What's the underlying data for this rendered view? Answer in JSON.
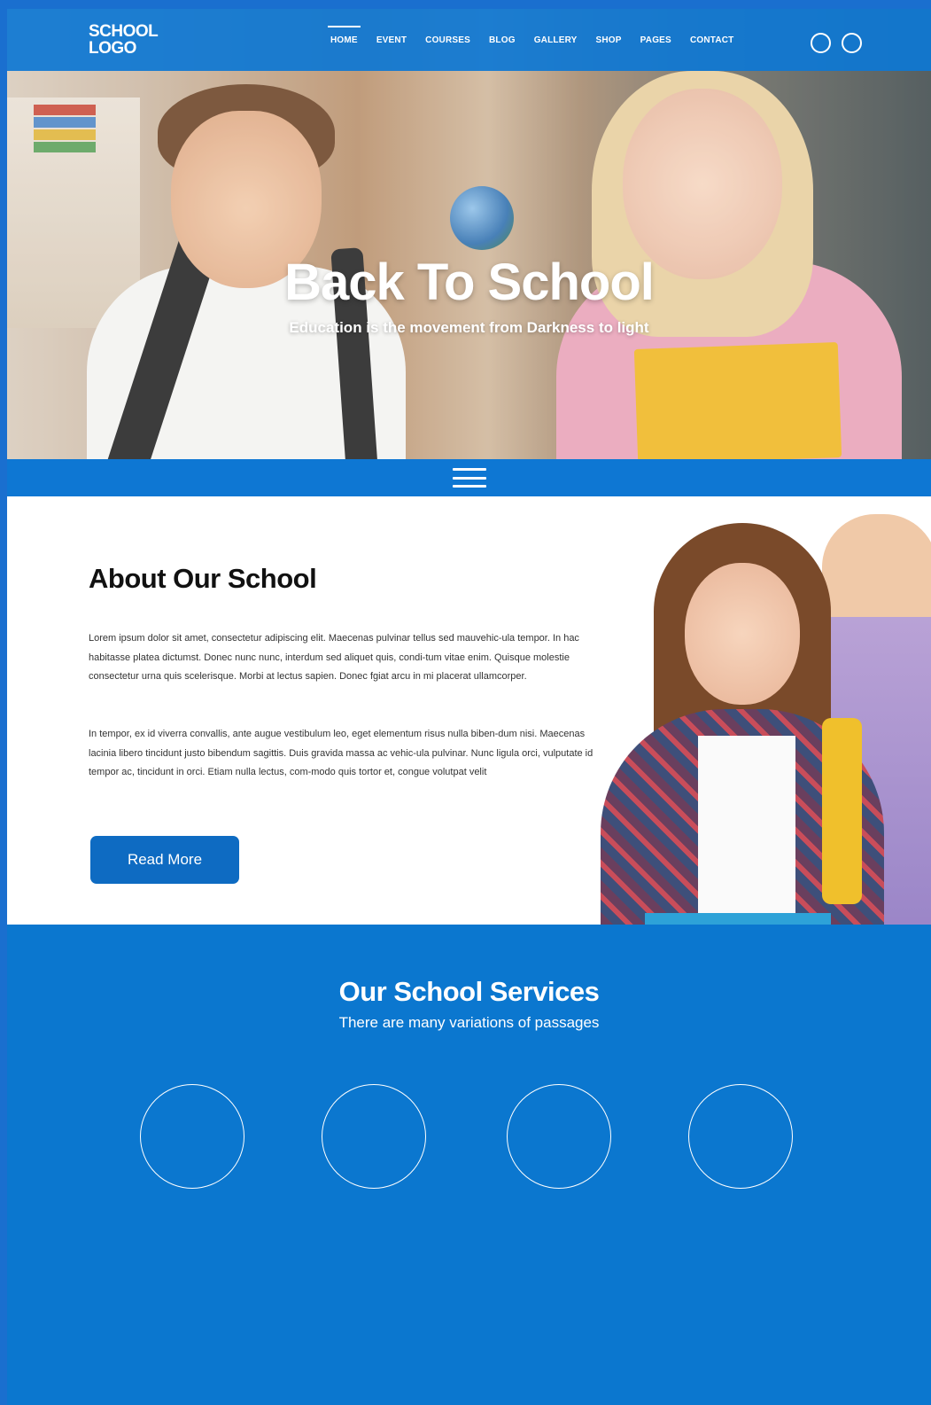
{
  "header": {
    "logo_line1": "SCHOOL",
    "logo_line2": "LOGO",
    "nav": [
      "HOME",
      "EVENT",
      "COURSES",
      "BLOG",
      "GALLERY",
      "SHOP",
      "PAGES",
      "CONTACT"
    ],
    "active_nav": "HOME",
    "icons": [
      "circle-icon",
      "circle-icon"
    ]
  },
  "hero": {
    "title": "Back To School",
    "subtitle": "Education is the movement from Darkness to light"
  },
  "menu_bar": {
    "icon": "hamburger-menu-icon"
  },
  "about": {
    "title": "About Our School",
    "paragraph1": "Lorem ipsum dolor sit amet, consectetur adipiscing elit. Maecenas pulvinar tellus sed mauvehic-ula tempor. In hac habitasse platea dictumst. Donec nunc nunc, interdum sed aliquet quis, condi-tum vitae enim. Quisque molestie consectetur urna quis scelerisque. Morbi at lectus sapien. Donec fgiat arcu in mi placerat ullamcorper.",
    "paragraph2": "In tempor, ex id viverra convallis, ante augue vestibulum leo, eget elementum risus nulla biben-dum nisi. Maecenas lacinia libero tincidunt justo bibendum sagittis. Duis gravida massa ac vehic-ula pulvinar. Nunc ligula orci, vulputate id tempor ac, tincidunt in orci. Etiam nulla lectus, com-modo quis tortor et, congue volutpat velit",
    "button_label": "Read More"
  },
  "services": {
    "title": "Our School Services",
    "subtitle": "There are many variations of passages",
    "circle_count": 4
  },
  "colors": {
    "primary_blue": "#0e77d3",
    "button_blue": "#0e6bc2",
    "white": "#ffffff"
  }
}
